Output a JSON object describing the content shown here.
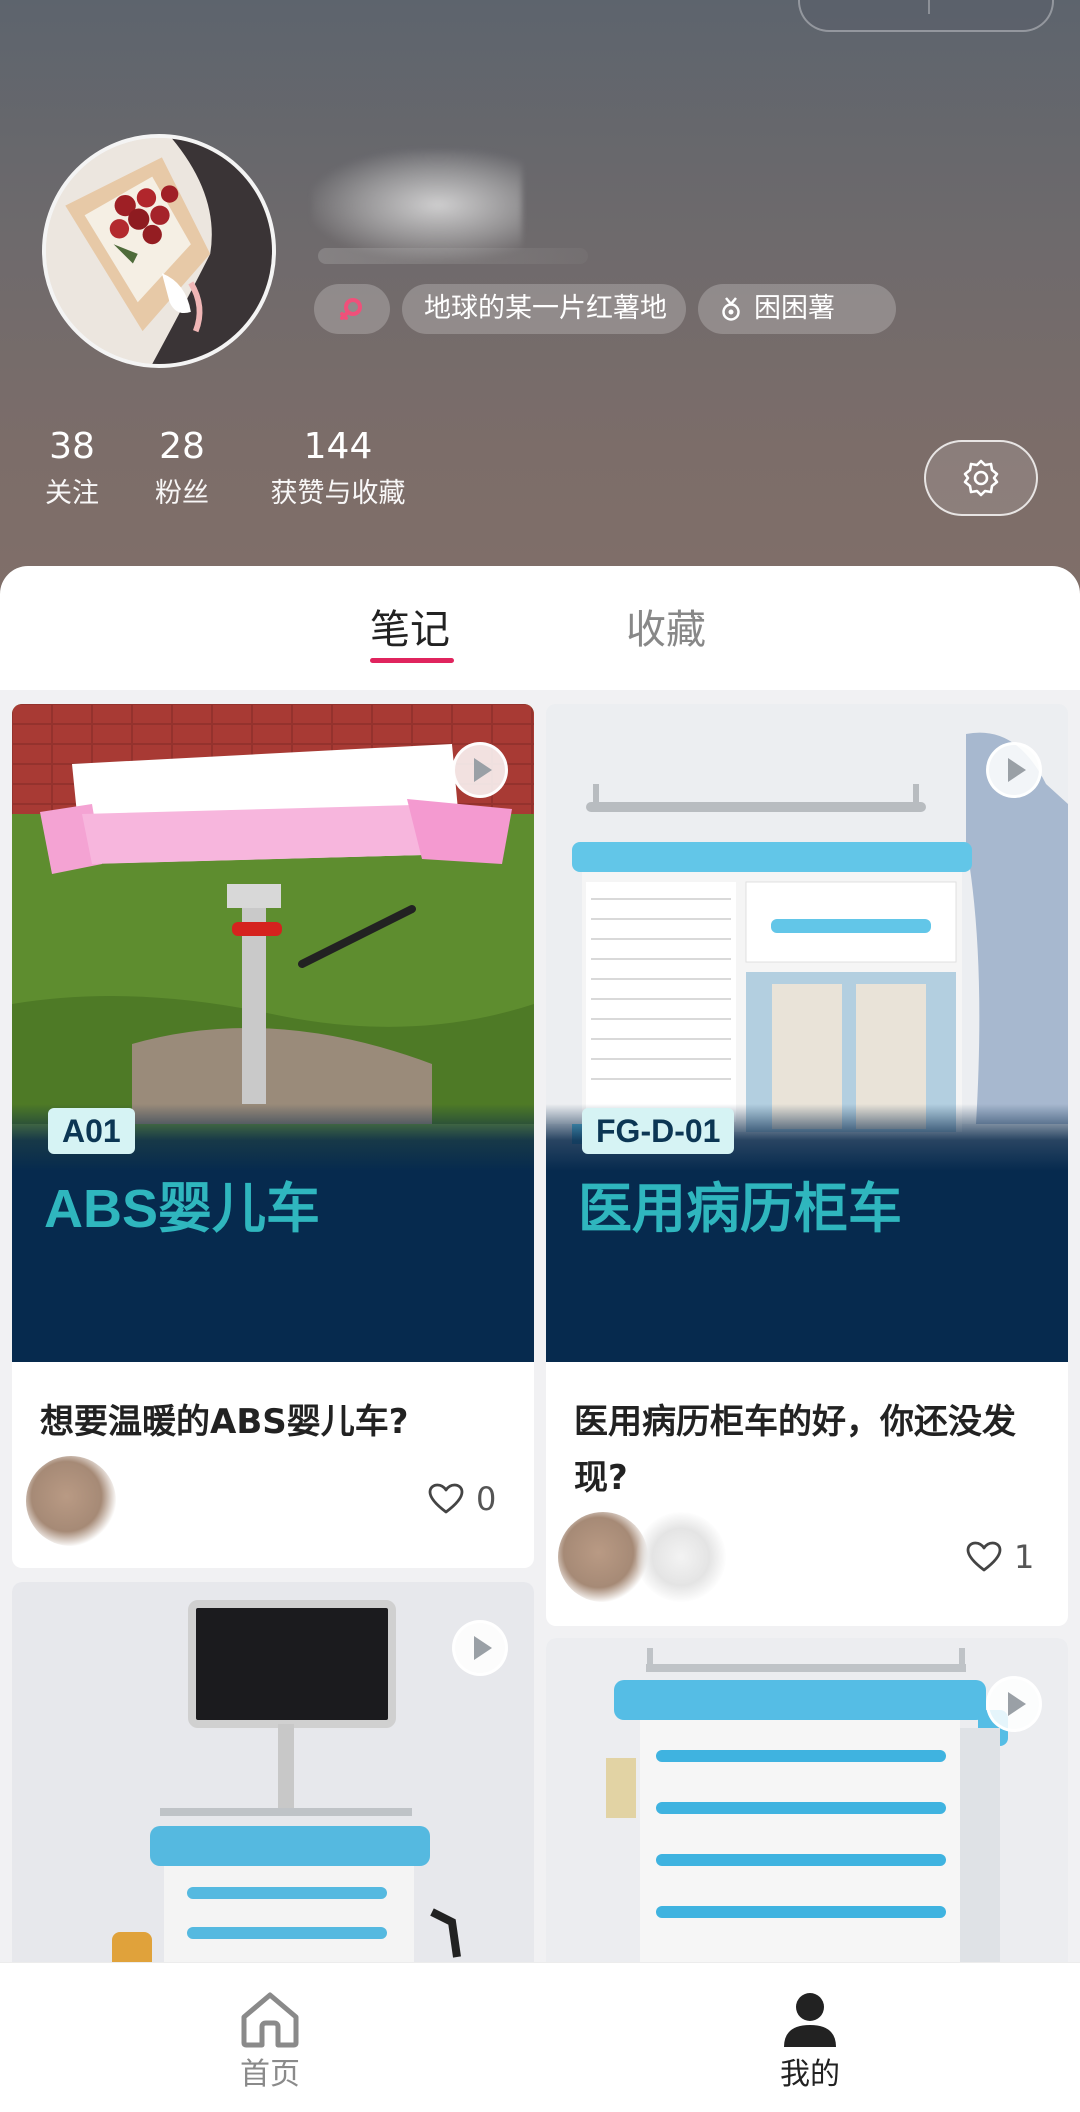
{
  "profile": {
    "tags": {
      "location": "地球的某一片红薯地",
      "title": "困困薯"
    },
    "stats": [
      {
        "value": "38",
        "label": "关注"
      },
      {
        "value": "28",
        "label": "粉丝"
      },
      {
        "value": "144",
        "label": "获赞与收藏"
      }
    ]
  },
  "tabs": {
    "notes": "笔记",
    "favorites": "收藏"
  },
  "cards": [
    {
      "code": "A01",
      "product": "ABS婴儿车",
      "title": "想要温暖的ABS婴儿车?",
      "likes": "0"
    },
    {
      "code": "FG-D-01",
      "product": "医用病历柜车",
      "title": "医用病历柜车的好，你还没发现?",
      "likes": "1"
    }
  ],
  "nav": {
    "home": "首页",
    "me": "我的"
  },
  "colors": {
    "accent": "#e0245e",
    "banner": "#062a4e",
    "product_text": "#2fb6be"
  }
}
